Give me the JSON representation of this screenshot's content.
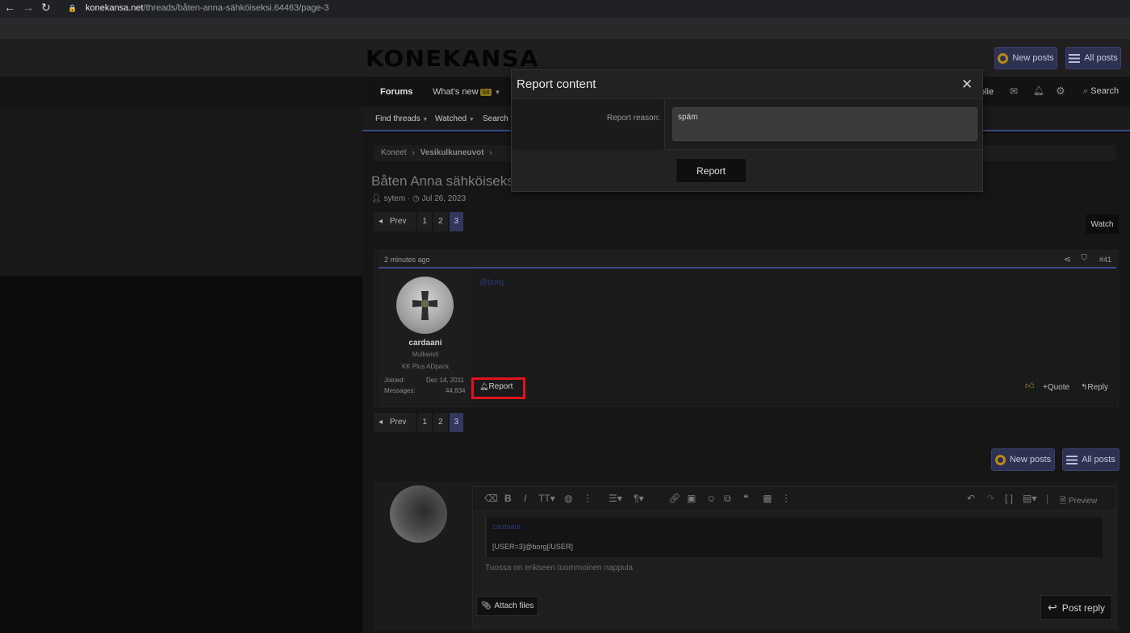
{
  "browser": {
    "back": "←",
    "forward": "→",
    "reload": "↻",
    "url_domain": "konekansa.net",
    "url_path": "/threads/båten-anna-sähköiseksi.64463/page-3"
  },
  "site": {
    "logo": "KONEKANSA",
    "new_posts": "New posts",
    "all_posts": "All posts"
  },
  "nav": {
    "forums": "Forums",
    "whats_new": "What's new",
    "whats_new_badge": "94",
    "profile_partial": "olie",
    "search": "Search",
    "find_threads": "Find threads",
    "watched": "Watched",
    "search_forums_partial": "Search fo"
  },
  "breadcrumb": {
    "item1": "Koneet",
    "item2": "Vesikulkuneuvot"
  },
  "thread": {
    "title": "Båten Anna sähköiseksi?",
    "author": "sytem",
    "date": "Jul 26, 2023",
    "watch": "Watch"
  },
  "pager": {
    "prev": "Prev",
    "pages": [
      "1",
      "2",
      "3"
    ]
  },
  "post": {
    "time": "2 minutes ago",
    "number": "#41",
    "username": "cardaani",
    "user_title": "Mulkwisti",
    "user_banner": "KK Plus ADpack",
    "joined_label": "Joined:",
    "joined_value": "Dec 14, 2011",
    "messages_label": "Messages:",
    "messages_value": "44,834",
    "mention": "@borg",
    "report": "Report",
    "quote": "Quote",
    "reply": "Reply"
  },
  "editor": {
    "preview": "Preview",
    "quote_author": "cardaani:",
    "quote_text": "[USER=3]@borg[/USER]",
    "body_text": "Tuossa on erikseen tuommoinen nappula",
    "attach_files": "Attach files",
    "post_reply": "Post reply"
  },
  "modal": {
    "title": "Report content",
    "close": "✕",
    "reason_label": "Report reason:",
    "reason_value": "späm",
    "submit": "Report"
  },
  "colors": {
    "accent": "#3a4a8a",
    "highlight": "#e0141e",
    "badge": "#8a7a12"
  }
}
